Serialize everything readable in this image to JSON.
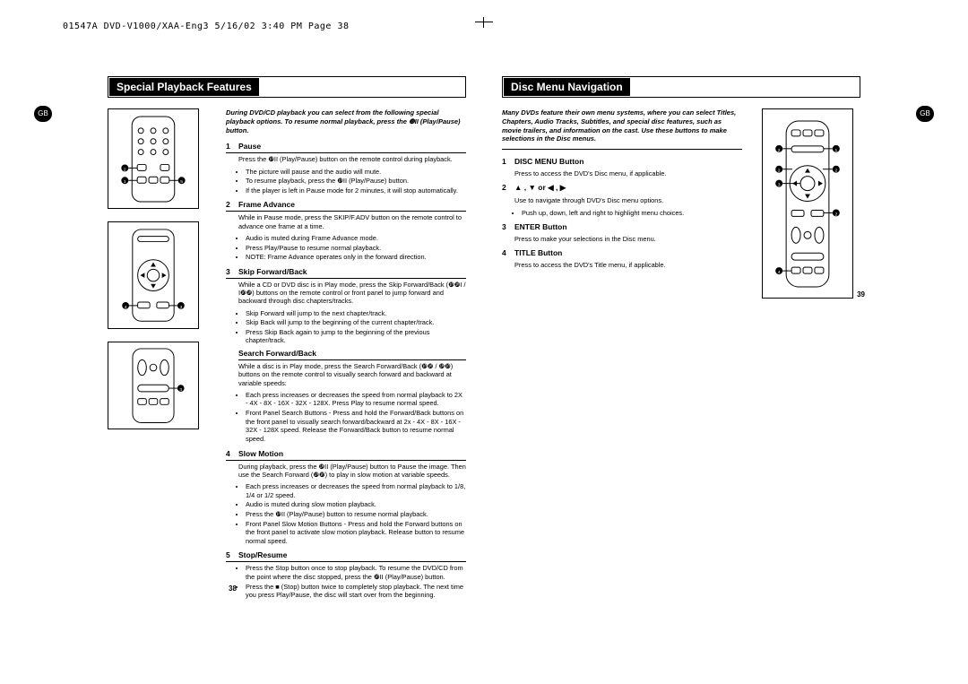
{
  "print_header": "01547A DVD-V1000/XAA-Eng3  5/16/02 3:40 PM  Page 38",
  "gb_label": "GB",
  "left": {
    "title": "Special Playback Features",
    "intro": "During DVD/CD playback you can select from the following special playback options. To resume normal playback, press the ❿II (Play/Pause) button.",
    "items": [
      {
        "num": "1",
        "title": "Pause",
        "body": "Press the ❿II (Play/Pause) button on the remote control during playback.",
        "bullets": [
          "The picture will pause and the audio will mute.",
          "To resume playback, press the ❿II (Play/Pause) button.",
          "If the player is left in Pause mode for 2 minutes, it will stop automatically."
        ]
      },
      {
        "num": "2",
        "title": "Frame Advance",
        "body": "While in Pause mode, press the SKIP/F.ADV button on the remote control to advance one frame at a time.",
        "bullets": [
          "Audio is muted during Frame Advance mode.",
          "Press Play/Pause to resume normal playback.",
          "NOTE: Frame Advance operates only in the forward direction."
        ]
      },
      {
        "num": "3",
        "title": "Skip Forward/Back",
        "body": "While a CD or DVD disc is in Play mode, press the Skip Forward/Back (❿❿I / I❿❿) buttons on the remote control or front panel to jump forward and backward through disc chapters/tracks.",
        "bullets": [
          "Skip Forward will jump to the next chapter/track.",
          "Skip Back will jump to the beginning of the current chapter/track.",
          "Press Skip Back again to jump to the beginning of the previous chapter/track."
        ],
        "sub_title": "Search Forward/Back",
        "sub_body": "While a disc is in Play mode, press the Search Forward/Back (❿❿ / ❿❿) buttons on the remote control to visually search forward and backward at variable speeds:",
        "sub_bullets": [
          "Each press increases or decreases the speed from normal playback to 2X - 4X - 8X - 16X - 32X - 128X. Press Play to resume normal speed.",
          "Front Panel Search Buttons - Press and hold the Forward/Back buttons on the front panel to visually search forward/backward at 2x - 4X - 8X - 16X - 32X - 128X speed. Release the Forward/Back button to resume normal speed."
        ]
      },
      {
        "num": "4",
        "title": "Slow Motion",
        "body": "During playback, press the ❿II (Play/Pause) button to Pause the image. Then use the Search Forward (❿❿) to play in slow motion at variable speeds.",
        "bullets": [
          "Each press increases or decreases the speed from normal playback to 1/8, 1/4 or 1/2 speed.",
          "Audio is muted during slow motion playback.",
          "Press the ❿II (Play/Pause) button to resume normal playback.",
          "Front Panel Slow Motion Buttons - Press and hold the Forward buttons on the front panel to activate slow motion playback. Release button to resume normal speed."
        ]
      },
      {
        "num": "5",
        "title": "Stop/Resume",
        "bullets": [
          "Press the Stop button once to stop playback. To resume the DVD/CD from the point where the disc stopped, press the ❿II (Play/Pause) button.",
          "Press the ■ (Stop) button twice to completely stop playback. The next time you press Play/Pause, the disc will start over from the beginning."
        ]
      }
    ],
    "pagenum": "38"
  },
  "right": {
    "title": "Disc Menu Navigation",
    "intro": "Many DVDs feature their own menu systems, where you can select Titles, Chapters, Audio Tracks, Subtitles, and special disc features, such as movie trailers, and information on the cast. Use these buttons to make selections in the Disc menus.",
    "items": [
      {
        "num": "1",
        "title": "DISC MENU Button",
        "body": "Press to access the DVD's Disc menu, if applicable."
      },
      {
        "num": "2",
        "title": "▲ , ▼ or ◀ , ▶",
        "body": "Use to navigate through DVD's Disc menu options.",
        "bullets": [
          "Push up, down, left and right to highlight menu choices."
        ]
      },
      {
        "num": "3",
        "title": "ENTER Button",
        "body": "Press to make your selections in the Disc menu."
      },
      {
        "num": "4",
        "title": "TITLE Button",
        "body": "Press to access the DVD's Title menu, if applicable."
      }
    ],
    "pagenum": "39"
  }
}
